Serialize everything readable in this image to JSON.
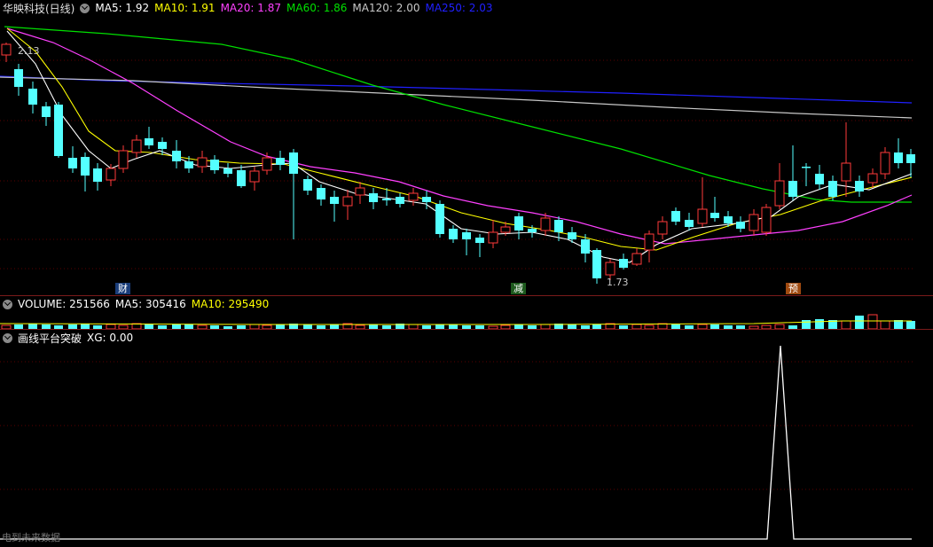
{
  "price_panel": {
    "title": "华映科技(日线)",
    "indicators": [
      {
        "label": "MA5: 1.92",
        "color": "#ffffff"
      },
      {
        "label": "MA10: 1.91",
        "color": "#ffff00"
      },
      {
        "label": "MA20: 1.87",
        "color": "#ff40ff"
      },
      {
        "label": "MA60: 1.86",
        "color": "#00e000"
      },
      {
        "label": "MA120: 2.00",
        "color": "#c8c8c8"
      },
      {
        "label": "MA250: 2.03",
        "color": "#2020ff"
      }
    ],
    "high_label": "2.13",
    "low_label": "1.73",
    "events": [
      {
        "label": "财",
        "color": "#3a7bd5"
      },
      {
        "label": "减",
        "color": "#4caf50"
      },
      {
        "label": "预",
        "color": "#e07020"
      }
    ]
  },
  "volume_panel": {
    "indicators": [
      {
        "label": "VOLUME: 251566",
        "color": "#ffffff"
      },
      {
        "label": "MA5: 305416",
        "color": "#ffffff"
      },
      {
        "label": "MA10: 295490",
        "color": "#ffff00"
      }
    ]
  },
  "signal_panel": {
    "indicators": [
      {
        "label": "画线平台突破",
        "color": "#ffffff"
      },
      {
        "label": "XG: 0.00",
        "color": "#ffffff"
      }
    ]
  },
  "footer": {
    "text": "电到未来数据"
  },
  "colors": {
    "up": "#ff3a3a",
    "down": "#54ffff",
    "grid": "#5a0000",
    "background": "#000000"
  },
  "icons": {
    "panel_toggle": "chevron-down-icon"
  }
}
